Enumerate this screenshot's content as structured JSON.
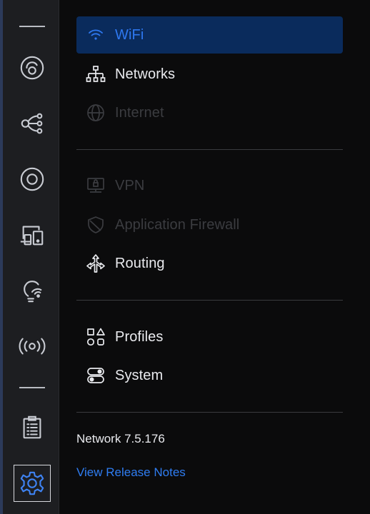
{
  "sidebar": {
    "items": [
      {
        "name": "dashboard",
        "icon": "speedometer-icon"
      },
      {
        "name": "topology",
        "icon": "topology-icon"
      },
      {
        "name": "devices",
        "icon": "unifi-device-icon"
      },
      {
        "name": "client-devices",
        "icon": "client-devices-icon"
      },
      {
        "name": "insights",
        "icon": "lightbulb-wifi-icon"
      },
      {
        "name": "radio",
        "icon": "radio-waves-icon"
      },
      {
        "name": "logs",
        "icon": "clipboard-list-icon"
      },
      {
        "name": "settings",
        "icon": "gear-icon",
        "active": true
      }
    ]
  },
  "menu": {
    "wifi": "WiFi",
    "networks": "Networks",
    "internet": "Internet",
    "vpn": "VPN",
    "application_firewall": "Application Firewall",
    "routing": "Routing",
    "profiles": "Profiles",
    "system": "System"
  },
  "footer": {
    "version": "Network 7.5.176",
    "release_notes": "View Release Notes"
  },
  "colors": {
    "accent": "#2e78f0",
    "selected_bg": "#0a2b5c",
    "rail_bg": "#1d1e21",
    "panel_bg": "#0b0b0c",
    "disabled_text": "#3b3c40"
  }
}
